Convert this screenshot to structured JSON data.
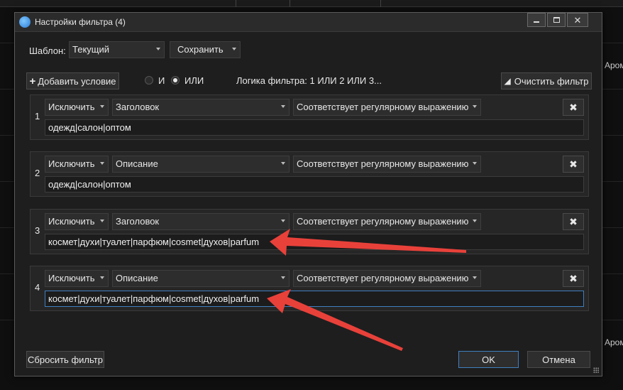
{
  "background": {
    "right_text": "Аром"
  },
  "dialog": {
    "title": "Настройки фильтра (4)",
    "template_label": "Шаблон:",
    "template_value": "Текущий",
    "save_label": "Сохранить",
    "add_condition_label": "Добавить условие",
    "radio_and_label": "И",
    "radio_or_label": "ИЛИ",
    "radio_selected": "ИЛИ",
    "logic_label": "Логика фильтра: 1 ИЛИ 2 ИЛИ 3...",
    "clear_filter_label": "Очистить фильтр",
    "reset_filter_label": "Сбросить фильтр",
    "ok_label": "OK",
    "cancel_label": "Отмена"
  },
  "conditions": [
    {
      "num": "1",
      "mode": "Исключить",
      "field": "Заголовок",
      "operator": "Соответствует регулярному выражению",
      "value": "одежд|салон|оптом"
    },
    {
      "num": "2",
      "mode": "Исключить",
      "field": "Описание",
      "operator": "Соответствует регулярному выражению",
      "value": "одежд|салон|оптом"
    },
    {
      "num": "3",
      "mode": "Исключить",
      "field": "Заголовок",
      "operator": "Соответствует регулярному выражению",
      "value": "космет|духи|туалет|парфюм|cosmet|духов|parfum"
    },
    {
      "num": "4",
      "mode": "Исключить",
      "field": "Описание",
      "operator": "Соответствует регулярному выражению",
      "value": "космет|духи|туалет|парфюм|cosmet|духов|parfum"
    }
  ],
  "colors": {
    "annotation_arrow": "#e8413a",
    "accent_focus": "#3f7fc0"
  }
}
